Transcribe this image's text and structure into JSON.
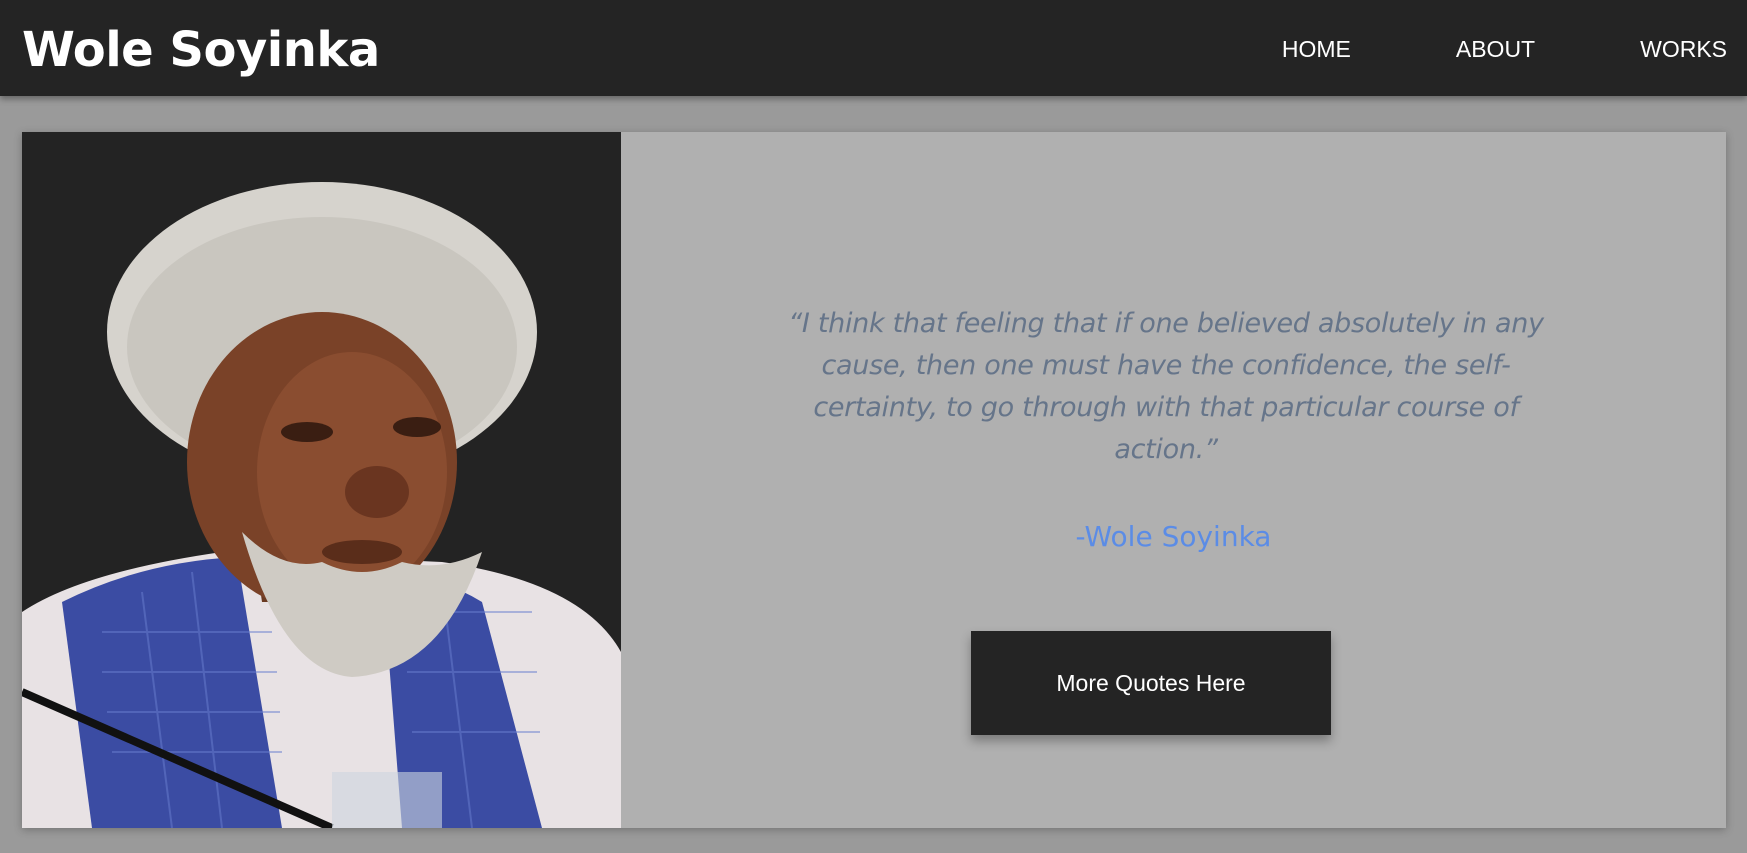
{
  "header": {
    "title": "Wole Soyinka",
    "nav": [
      {
        "label": "HOME"
      },
      {
        "label": "ABOUT"
      },
      {
        "label": "WORKS"
      }
    ]
  },
  "hero": {
    "quote": "“I think that feeling that if one believed absolutely in any cause, then one must have the confidence, the self-certainty, to go through with that particular course of action.”",
    "author": "-Wole Soyinka",
    "button_label": "More Quotes Here"
  },
  "colors": {
    "header_bg": "#242424",
    "page_bg": "#9a9a9a",
    "card_bg": "#b0b0b0",
    "quote_text": "#66758a",
    "author_text": "#5b8ce6",
    "button_bg": "#242424"
  }
}
